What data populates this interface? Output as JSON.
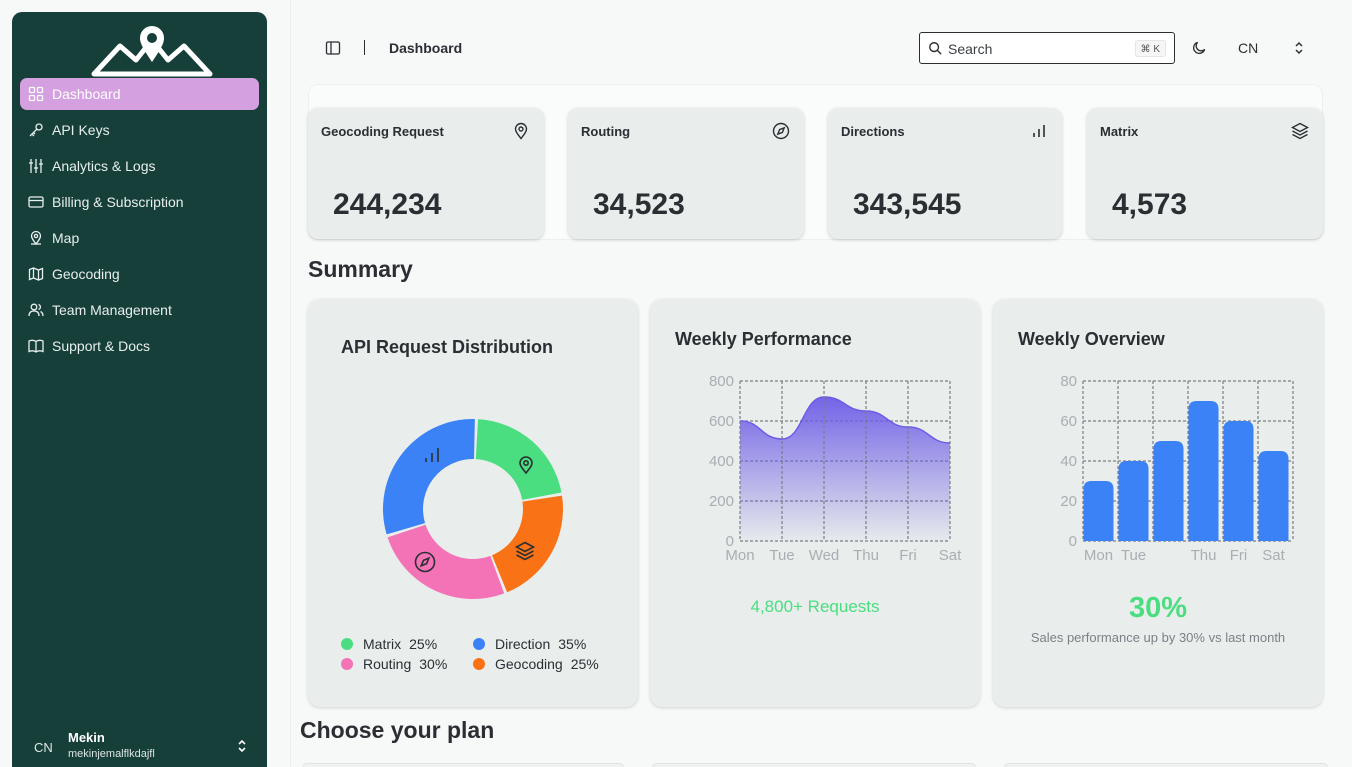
{
  "sidebar": {
    "items": [
      {
        "label": "Dashboard",
        "icon": "grid-icon",
        "active": true
      },
      {
        "label": "API Keys",
        "icon": "key-icon"
      },
      {
        "label": "Analytics & Logs",
        "icon": "sliders-icon"
      },
      {
        "label": "Billing & Subscription",
        "icon": "credit-card-icon"
      },
      {
        "label": "Map",
        "icon": "map-pin-icon"
      },
      {
        "label": "Geocoding",
        "icon": "map-icon"
      },
      {
        "label": "Team Management",
        "icon": "users-icon"
      },
      {
        "label": "Support & Docs",
        "icon": "book-icon"
      }
    ],
    "user": {
      "lang": "CN",
      "name": "Mekin",
      "email": "mekinjemalflkdajfl"
    },
    "colors": {
      "bg": "#163f3a",
      "active": "#d4a0e0"
    }
  },
  "header": {
    "breadcrumb": "Dashboard",
    "search_placeholder": "Search",
    "shortcut": "⌘ K",
    "lang": "CN"
  },
  "stats": [
    {
      "title": "Geocoding Request",
      "value": "244,234",
      "icon": "map-pin-icon"
    },
    {
      "title": "Routing",
      "value": "34,523",
      "icon": "compass-icon"
    },
    {
      "title": "Directions",
      "value": "343,545",
      "icon": "bar-chart-icon"
    },
    {
      "title": "Matrix",
      "value": "4,573",
      "icon": "layers-icon"
    }
  ],
  "summary_title": "Summary",
  "choose_title": "Choose your plan",
  "distribution": {
    "title": "API Request Distribution",
    "legend": [
      {
        "name": "Matrix",
        "pct": "25%",
        "color": "#4ade80"
      },
      {
        "name": "Direction",
        "pct": "35%",
        "color": "#3b82f6"
      },
      {
        "name": "Routing",
        "pct": "30%",
        "color": "#f472b6"
      },
      {
        "name": "Geocoding",
        "pct": "25%",
        "color": "#f97316"
      }
    ]
  },
  "performance": {
    "title": "Weekly Performance",
    "caption": "4,800+ Requests"
  },
  "overview": {
    "title": "Weekly Overview",
    "headline": "30%",
    "caption": "Sales performance up by 30% vs last month"
  },
  "chart_data": [
    {
      "type": "pie",
      "categories": [
        "Direction",
        "Matrix",
        "Geocoding",
        "Routing"
      ],
      "values": [
        35,
        25,
        25,
        30
      ],
      "colors": [
        "#3b82f6",
        "#4ade80",
        "#f97316",
        "#f472b6"
      ]
    },
    {
      "type": "area",
      "categories": [
        "Mon",
        "Tue",
        "Wed",
        "Thu",
        "Fri",
        "Sat"
      ],
      "values": [
        600,
        510,
        720,
        650,
        570,
        490
      ],
      "yticks": [
        0,
        200,
        400,
        600,
        800
      ],
      "ylim": [
        0,
        800
      ],
      "color": "#6c5ce7",
      "grid": true
    },
    {
      "type": "bar",
      "categories": [
        "Mon",
        "Tue",
        "",
        "Thu",
        "Fri",
        "Sat"
      ],
      "values": [
        30,
        40,
        50,
        70,
        60,
        45
      ],
      "yticks": [
        0,
        20,
        40,
        60,
        80
      ],
      "ylim": [
        0,
        80
      ],
      "color": "#3b82f6",
      "grid": true
    }
  ]
}
